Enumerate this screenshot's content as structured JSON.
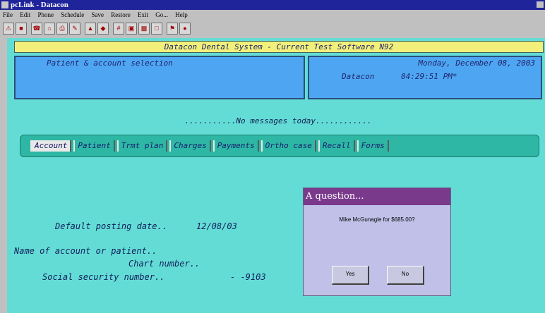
{
  "window": {
    "title": "pcLink - Datacon"
  },
  "menu": [
    "File",
    "Edit",
    "Phone",
    "Schedule",
    "Save",
    "Restore",
    "Exit",
    "Go...",
    "Help"
  ],
  "screen": {
    "header": "Datacon Dental System  - Current Test Software N92",
    "section_title": "Patient & account selection",
    "date": "Monday, December 08, 2003",
    "company": "Datacon",
    "time": "04:29:51 PM*",
    "messages": "...........No messages today............",
    "tabs": [
      "Account",
      "Patient",
      "Trmt plan",
      "Charges",
      "Payments",
      "Ortho case",
      "Recall",
      "Forms"
    ],
    "posting_label": "Default posting date..",
    "posting_date": "12/08/03",
    "name_label": "Name of account or patient..",
    "chart_label": "Chart number..",
    "ssn_label": "Social security number..",
    "ssn_value": "-   -9103"
  },
  "dialog": {
    "title": "A question...",
    "message": "Mike McGunagle for $685.00?",
    "yes": "Yes",
    "no": "No"
  }
}
